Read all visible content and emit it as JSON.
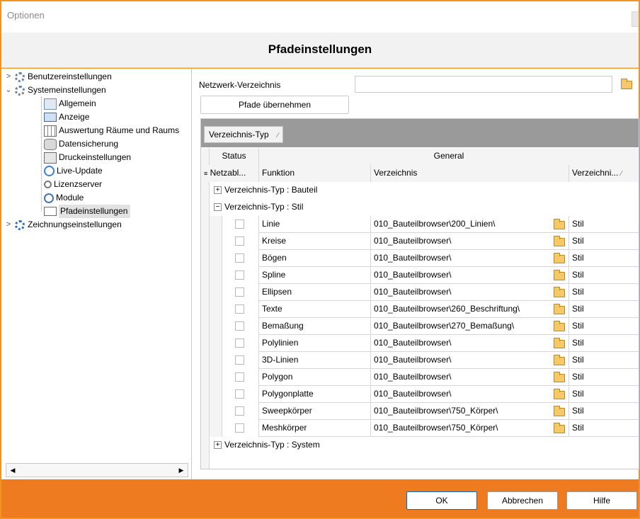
{
  "window": {
    "title": "Optionen"
  },
  "header": {
    "title": "Pfadeinstellungen"
  },
  "tree": {
    "items": [
      {
        "label": "Benutzereinstellungen",
        "expanded": false
      },
      {
        "label": "Systemeinstellungen",
        "expanded": true
      },
      {
        "label": "Allgemein"
      },
      {
        "label": "Anzeige"
      },
      {
        "label": "Auswertung Räume und Raums"
      },
      {
        "label": "Datensicherung"
      },
      {
        "label": "Druckeinstellungen"
      },
      {
        "label": "Live-Update"
      },
      {
        "label": "Lizenzserver"
      },
      {
        "label": "Module"
      },
      {
        "label": "Pfadeinstellungen",
        "selected": true
      },
      {
        "label": "Zeichnungseinstellungen",
        "expanded": false
      }
    ]
  },
  "form": {
    "network_label": "Netzwerk-Verzeichnis",
    "network_value": "",
    "apply_button": "Pfade übernehmen"
  },
  "grid": {
    "group_chip": "Verzeichnis-Typ",
    "band_status": "Status",
    "band_general": "General",
    "columns": [
      "Netzabl...",
      "Funktion",
      "Verzeichnis",
      "Verzeichni..."
    ],
    "groups": [
      {
        "label": "Verzeichnis-Typ : Bauteil",
        "expanded": false
      },
      {
        "label": "Verzeichnis-Typ : Stil",
        "expanded": true
      },
      {
        "label": "Verzeichnis-Typ : System",
        "expanded": false
      }
    ],
    "rows": [
      {
        "funktion": "Linie",
        "verzeichnis": "010_Bauteilbrowser\\200_Linien\\",
        "typ": "Stil"
      },
      {
        "funktion": "Kreise",
        "verzeichnis": "010_Bauteilbrowser\\",
        "typ": "Stil"
      },
      {
        "funktion": "Bögen",
        "verzeichnis": "010_Bauteilbrowser\\",
        "typ": "Stil"
      },
      {
        "funktion": "Spline",
        "verzeichnis": "010_Bauteilbrowser\\",
        "typ": "Stil"
      },
      {
        "funktion": "Ellipsen",
        "verzeichnis": "010_Bauteilbrowser\\",
        "typ": "Stil"
      },
      {
        "funktion": "Texte",
        "verzeichnis": "010_Bauteilbrowser\\260_Beschriftung\\",
        "typ": "Stil"
      },
      {
        "funktion": "Bemaßung",
        "verzeichnis": "010_Bauteilbrowser\\270_Bemaßung\\",
        "typ": "Stil"
      },
      {
        "funktion": "Polylinien",
        "verzeichnis": "010_Bauteilbrowser\\",
        "typ": "Stil"
      },
      {
        "funktion": "3D-Linien",
        "verzeichnis": "010_Bauteilbrowser\\",
        "typ": "Stil"
      },
      {
        "funktion": "Polygon",
        "verzeichnis": "010_Bauteilbrowser\\",
        "typ": "Stil"
      },
      {
        "funktion": "Polygonplatte",
        "verzeichnis": "010_Bauteilbrowser\\",
        "typ": "Stil"
      },
      {
        "funktion": "Sweepkörper",
        "verzeichnis": "010_Bauteilbrowser\\750_Körper\\",
        "typ": "Stil"
      },
      {
        "funktion": "Meshkörper",
        "verzeichnis": "010_Bauteilbrowser\\750_Körper\\",
        "typ": "Stil"
      }
    ]
  },
  "buttons": {
    "ok": "OK",
    "cancel": "Abbrechen",
    "help": "Hilfe"
  },
  "colors": {
    "accent": "#ee7b1f",
    "frame": "#f29423",
    "groupbar": "#9a9a9a"
  }
}
